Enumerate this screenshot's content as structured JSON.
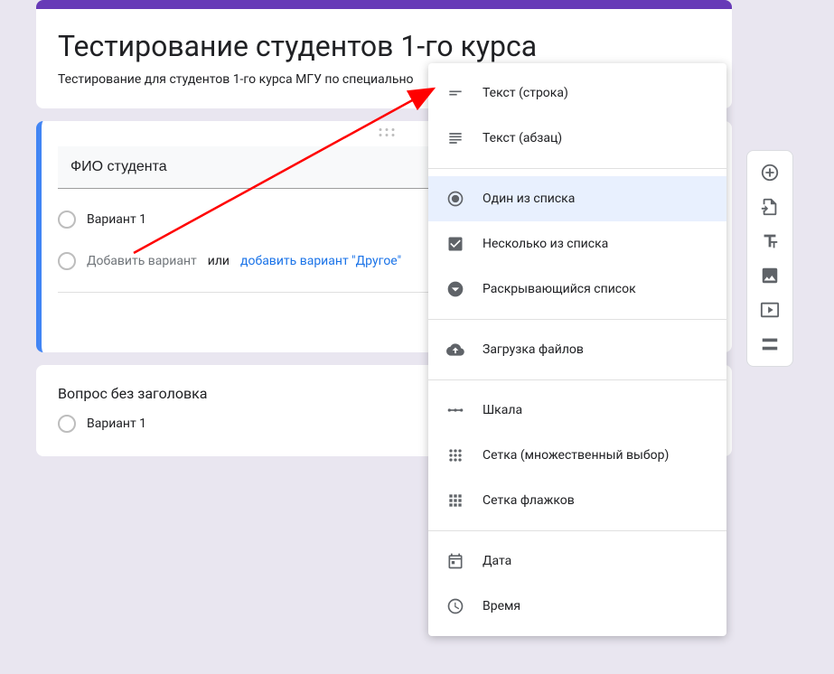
{
  "form": {
    "title": "Тестирование студентов 1-го курса",
    "description": "Тестирование для студентов 1-го курса МГУ по специально"
  },
  "question_active": {
    "title": "ФИО студента",
    "option1": "Вариант 1",
    "add_option": "Добавить вариант",
    "or": "или",
    "add_other": "добавить вариант \"Другое\""
  },
  "question2": {
    "title": "Вопрос без заголовка",
    "option1": "Вариант 1"
  },
  "type_menu": {
    "items": [
      {
        "icon": "short-text",
        "label": "Текст (строка)"
      },
      {
        "icon": "paragraph",
        "label": "Текст (абзац)"
      },
      {
        "icon": "radio",
        "label": "Один из списка",
        "selected": true
      },
      {
        "icon": "checkbox",
        "label": "Несколько из списка"
      },
      {
        "icon": "dropdown",
        "label": "Раскрывающийся список"
      },
      {
        "icon": "upload",
        "label": "Загрузка файлов"
      },
      {
        "icon": "linear",
        "label": "Шкала"
      },
      {
        "icon": "grid-radio",
        "label": "Сетка (множественный выбор)"
      },
      {
        "icon": "grid-check",
        "label": "Сетка флажков"
      },
      {
        "icon": "date",
        "label": "Дата"
      },
      {
        "icon": "time",
        "label": "Время"
      }
    ],
    "separators_after": [
      1,
      4,
      5,
      8
    ]
  },
  "side_toolbar": {
    "items": [
      "add-question",
      "import-question",
      "add-title",
      "add-image",
      "add-video",
      "add-section"
    ]
  }
}
